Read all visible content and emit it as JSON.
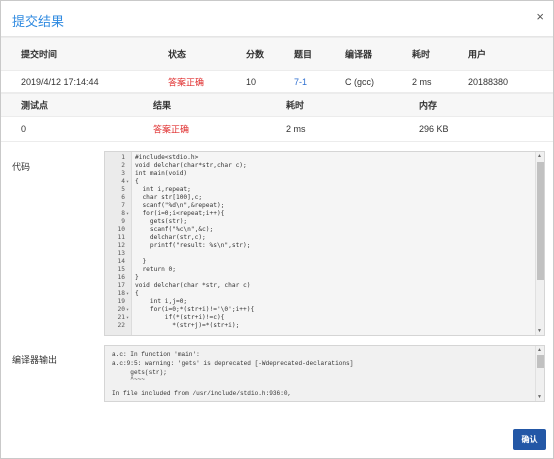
{
  "dialog": {
    "title": "提交结果",
    "close_label": "×"
  },
  "submission": {
    "headers": [
      "提交时间",
      "状态",
      "分数",
      "题目",
      "编译器",
      "耗时",
      "用户"
    ],
    "row": {
      "time": "2019/4/12 17:14:44",
      "status": "答案正确",
      "score": "10",
      "problem": "7-1",
      "compiler": "C (gcc)",
      "elapsed": "2 ms",
      "user": "20188380"
    }
  },
  "testpoints": {
    "headers": [
      "测试点",
      "结果",
      "耗时",
      "内存"
    ],
    "row": {
      "id": "0",
      "result": "答案正确",
      "elapsed": "2 ms",
      "memory": "296 KB"
    }
  },
  "code_section": {
    "label": "代码",
    "lines": [
      {
        "n": "1",
        "fold": "",
        "text": "#include<stdio.h>"
      },
      {
        "n": "2",
        "fold": "",
        "text": "void delchar(char*str,char c);"
      },
      {
        "n": "3",
        "fold": "",
        "text": "int main(void)"
      },
      {
        "n": "4",
        "fold": "▾",
        "text": "{"
      },
      {
        "n": "5",
        "fold": "",
        "text": "  int i,repeat;"
      },
      {
        "n": "6",
        "fold": "",
        "text": "  char str[100],c;"
      },
      {
        "n": "7",
        "fold": "",
        "text": "  scanf(\"%d\\n\",&repeat);"
      },
      {
        "n": "8",
        "fold": "▾",
        "text": "  for(i=0;i<repeat;i++){"
      },
      {
        "n": "9",
        "fold": "",
        "text": "    gets(str);"
      },
      {
        "n": "10",
        "fold": "",
        "text": "    scanf(\"%c\\n\",&c);"
      },
      {
        "n": "11",
        "fold": "",
        "text": "    delchar(str,c);"
      },
      {
        "n": "12",
        "fold": "",
        "text": "    printf(\"result: %s\\n\",str);"
      },
      {
        "n": "13",
        "fold": "",
        "text": ""
      },
      {
        "n": "14",
        "fold": "",
        "text": "  }"
      },
      {
        "n": "15",
        "fold": "",
        "text": "  return 0;"
      },
      {
        "n": "16",
        "fold": "",
        "text": "}"
      },
      {
        "n": "17",
        "fold": "",
        "text": "void delchar(char *str, char c)"
      },
      {
        "n": "18",
        "fold": "▾",
        "text": "{"
      },
      {
        "n": "19",
        "fold": "",
        "text": "    int i,j=0;"
      },
      {
        "n": "20",
        "fold": "▾",
        "text": "    for(i=0;*(str+i)!='\\0';i++){"
      },
      {
        "n": "21",
        "fold": "▾",
        "text": "        if(*(str+i)!=c){"
      },
      {
        "n": "22",
        "fold": "",
        "text": "          *(str+j)=*(str+i);"
      }
    ]
  },
  "compile_section": {
    "label": "编译器输出",
    "lines": [
      "a.c: In function 'main':",
      "a.c:9:5: warning: 'gets' is deprecated [-Wdeprecated-declarations]",
      "     gets(str);",
      "     ^~~~",
      "In file included from /usr/include/stdio.h:936:0,"
    ]
  },
  "footer": {
    "confirm_label": "确认"
  },
  "colors": {
    "accent": "#2f8ae0",
    "status_red": "#e03030",
    "link_blue": "#2f6fd0",
    "button": "#2357a6"
  }
}
